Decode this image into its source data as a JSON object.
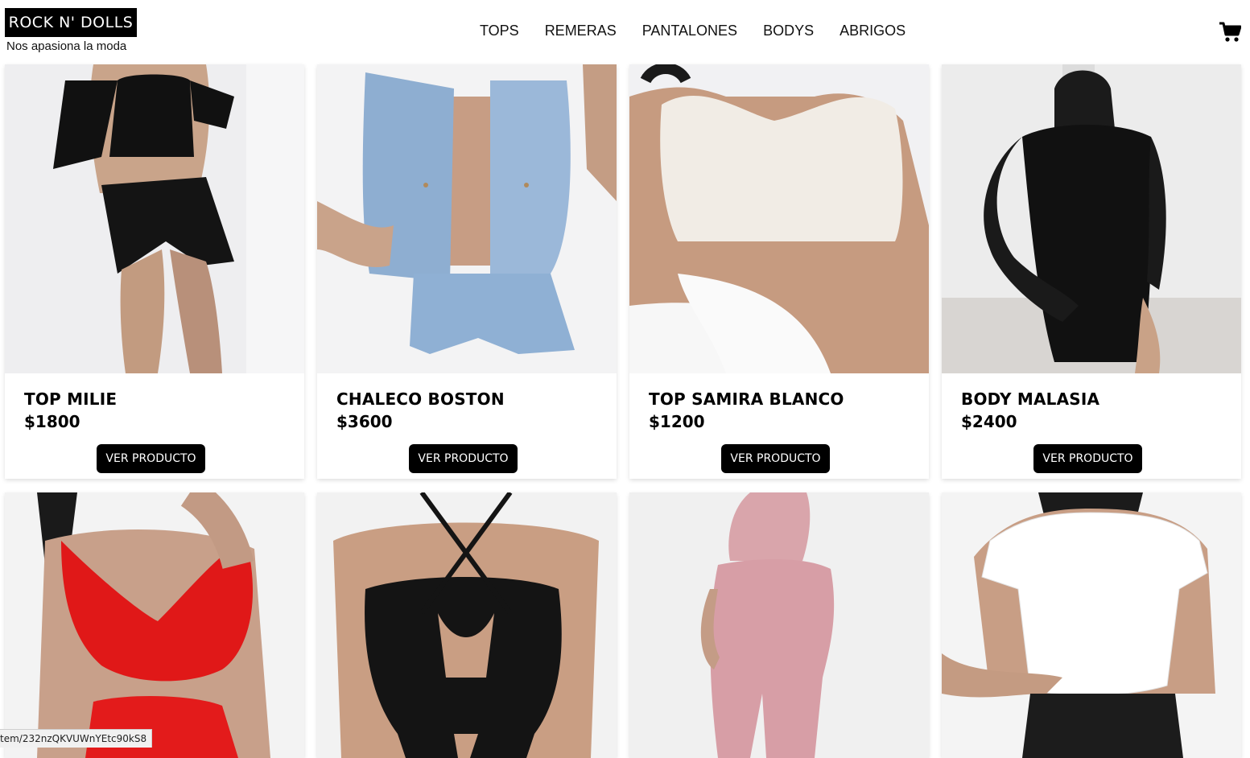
{
  "header": {
    "logo": "ROCK N' DOLLS",
    "tagline": "Nos apasiona la moda",
    "nav": [
      "TOPS",
      "REMERAS",
      "PANTALONES",
      "BODYS",
      "ABRIGOS"
    ],
    "cart_icon": "shopping-cart-icon"
  },
  "products": [
    {
      "name": "TOP MILIE",
      "price": "$1800",
      "button": "VER PRODUCTO"
    },
    {
      "name": "CHALECO BOSTON",
      "price": "$3600",
      "button": "VER PRODUCTO"
    },
    {
      "name": "TOP SAMIRA BLANCO",
      "price": "$1200",
      "button": "VER PRODUCTO"
    },
    {
      "name": "BODY MALASIA",
      "price": "$2400",
      "button": "VER PRODUCTO"
    }
  ],
  "second_row_images": [
    "red-halter-top",
    "black-cutout-body",
    "pink-set",
    "white-tshirt"
  ],
  "status_bar": "tem/232nzQKVUWnYEtc90kS8",
  "colors": {
    "primary": "#000000",
    "background": "#ffffff"
  }
}
